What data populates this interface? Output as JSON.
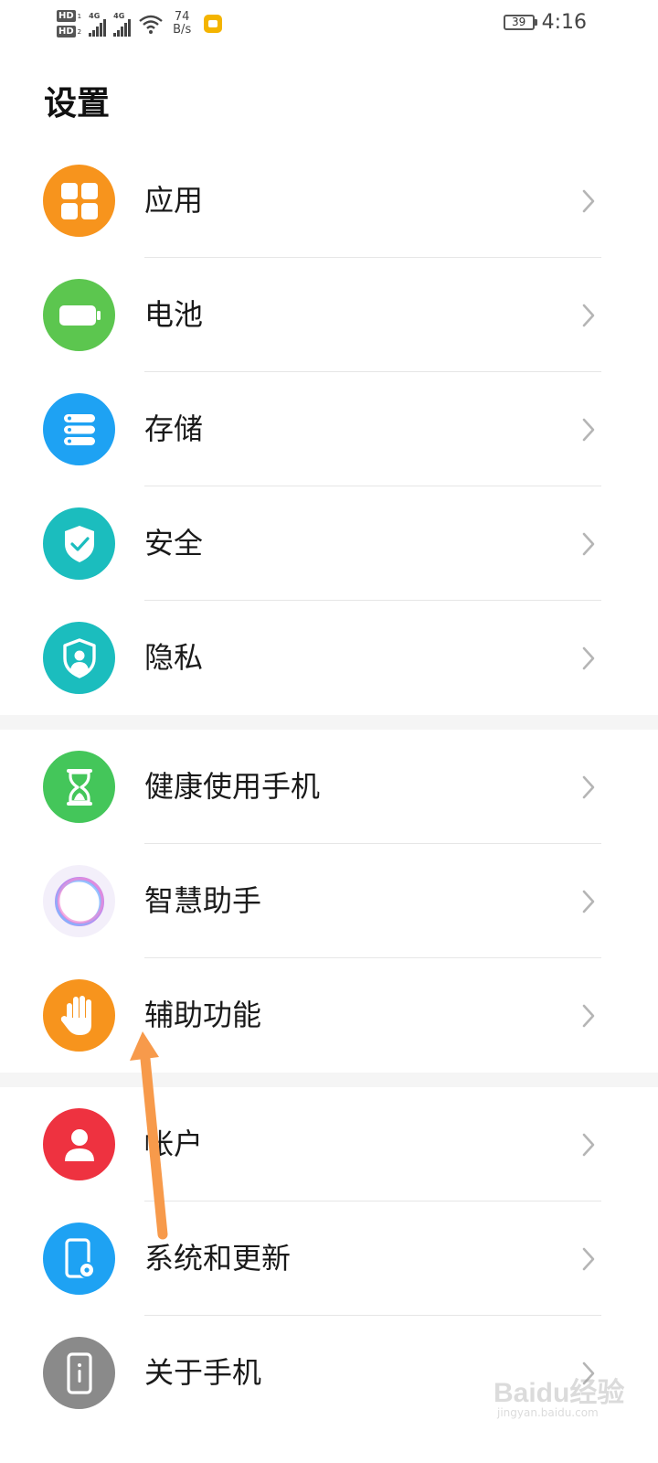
{
  "status_bar": {
    "hd1": "HD",
    "hd1_index": "1",
    "hd2": "HD",
    "hd2_index": "2",
    "network1": "4G",
    "network2": "4G",
    "speed_value": "74",
    "speed_unit": "B/s",
    "battery_level": "39",
    "time": "4:16"
  },
  "page": {
    "title": "设置"
  },
  "groups": [
    {
      "items": [
        {
          "label": "应用",
          "icon": "apps-icon",
          "color": "#F7941D"
        },
        {
          "label": "电池",
          "icon": "battery-icon",
          "color": "#5CC64F"
        },
        {
          "label": "存储",
          "icon": "storage-icon",
          "color": "#1EA2F3"
        },
        {
          "label": "安全",
          "icon": "security-shield-icon",
          "color": "#1BBDBE"
        },
        {
          "label": "隐私",
          "icon": "privacy-icon",
          "color": "#1BBDBE"
        }
      ]
    },
    {
      "items": [
        {
          "label": "健康使用手机",
          "icon": "hourglass-icon",
          "color": "#44C65A"
        },
        {
          "label": "智慧助手",
          "icon": "smart-assistant-icon",
          "color": "#B98BF0"
        },
        {
          "label": "辅助功能",
          "icon": "hand-icon",
          "color": "#F7941D"
        }
      ]
    },
    {
      "items": [
        {
          "label": "帐户",
          "icon": "account-icon",
          "color": "#EE3240"
        },
        {
          "label": "系统和更新",
          "icon": "system-update-icon",
          "color": "#1EA2F3"
        },
        {
          "label": "关于手机",
          "icon": "about-phone-icon",
          "color": "#8A8A8A"
        }
      ]
    }
  ],
  "annotation": {
    "arrow_color": "#F79A4B"
  },
  "watermark": {
    "text": "Baidu经验",
    "subtext": "jingyan.baidu.com"
  }
}
